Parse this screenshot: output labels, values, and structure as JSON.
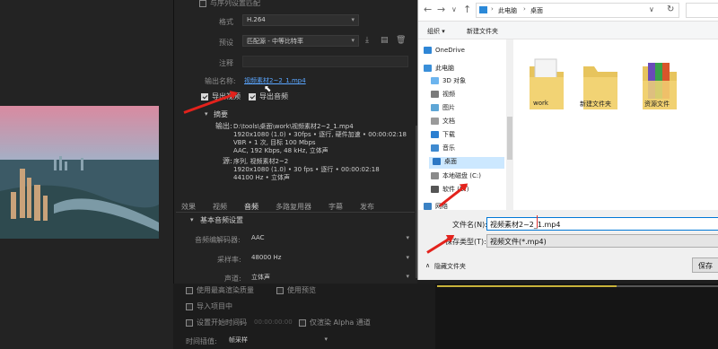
{
  "export": {
    "match_source_label": "与序列设置匹配",
    "format_label": "格式",
    "format_value": "H.264",
    "preset_label": "预设",
    "preset_value": "匹配源 - 中等比特率",
    "comment_label": "注释",
    "output_name_label": "输出名称:",
    "output_name_value": "视频素材2~2_1.mp4",
    "export_video_label": "导出视频",
    "export_audio_label": "导出音频",
    "summary_label": "摘要",
    "output_label": "输出:",
    "output_line1": "D:\\tools\\桌面\\work\\视频素材2~2_1.mp4",
    "output_line2": "1920x1080 (1.0) • 30fps • 逐行, 硬件加速 • 00:00:02:18",
    "output_line3": "VBR • 1 次, 目标 100 Mbps",
    "output_line4": "AAC, 192 Kbps, 48 kHz, 立体声",
    "source_label": "源:",
    "source_line1": "序列, 视频素材2~2",
    "source_line2": "1920x1080 (1.0) • 30 fps • 逐行 • 00:00:02:18",
    "source_line3": "44100 Hz • 立体声",
    "tabs": [
      "效果",
      "视频",
      "音频",
      "多路复用器",
      "字幕",
      "发布"
    ],
    "audio_basic_label": "基本音频设置",
    "audio_format_label": "音频编解码器:",
    "audio_format_value": "AAC",
    "sample_rate_label": "采样率:",
    "sample_rate_value": "48000 Hz",
    "channels_label": "声道:",
    "channels_value": "立体声"
  },
  "bottom": {
    "max_render_label": "使用最高渲染质量",
    "use_preview_label": "使用预览",
    "import_project_label": "导入项目中",
    "set_start_label": "设置开始时间码",
    "start_tc": "00:00:00:00",
    "alpha_label": "仅渲染 Alpha 通道",
    "interp_label": "时间插值:",
    "interp_value": "帧采样"
  },
  "dialog": {
    "breadcrumb": [
      "此电脑",
      "桌面"
    ],
    "toolbar_organize": "组织 ▾",
    "toolbar_new_folder": "新建文件夹",
    "nav_items": [
      "OneDrive",
      "此电脑",
      "3D 对象",
      "视频",
      "图片",
      "文档",
      "下载",
      "音乐",
      "桌面",
      "本地磁盘 (C:)",
      "软件 (D:)",
      "网络"
    ],
    "folders": [
      "work",
      "新建文件夹",
      "资源文件"
    ],
    "filename_label": "文件名(N):",
    "filename_value": "视频素材2~2_1.mp4",
    "filetype_label": "保存类型(T):",
    "filetype_value": "视频文件(*.mp4)",
    "hide_folders": "隐藏文件夹",
    "save_label": "保存"
  }
}
